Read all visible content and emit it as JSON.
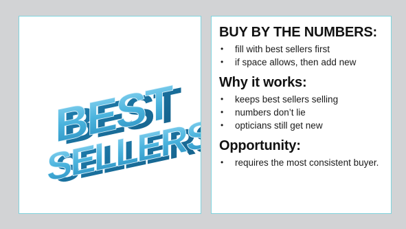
{
  "image_panel": {
    "logo_lines": [
      "BEST",
      "SELLERS"
    ],
    "logo_color": "#4ab3dd"
  },
  "text_panel": {
    "sections": [
      {
        "heading": "BUY BY THE NUMBERS:",
        "bullets": [
          "fill with best sellers first",
          "if space allows, then add new"
        ]
      },
      {
        "heading": "Why it works:",
        "bullets": [
          "keeps best sellers selling",
          "numbers don’t lie",
          "opticians still get new"
        ]
      },
      {
        "heading": "Opportunity:",
        "bullets": [
          "requires the most consistent buyer."
        ]
      }
    ]
  },
  "colors": {
    "background": "#d2d3d5",
    "panel_border": "#7fd3dd",
    "text": "#111111"
  }
}
